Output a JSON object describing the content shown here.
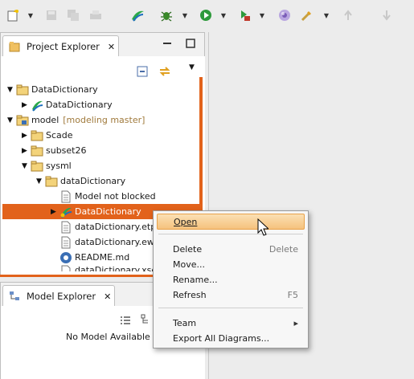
{
  "toolbar": {
    "icons": [
      "new-wizard-icon",
      "save-icon",
      "save-all-icon",
      "print-icon",
      "scade-icon",
      "debug-icon",
      "run-icon",
      "external-tools-icon",
      "globe-icon",
      "tool-icon",
      "back-icon",
      "forward-icon"
    ]
  },
  "project_explorer": {
    "tab_label": "Project Explorer",
    "tree": [
      {
        "label": "DataDictionary",
        "decoration": ""
      },
      {
        "label": "DataDictionary",
        "decoration": ""
      },
      {
        "label": "model",
        "decoration": "[modeling master]"
      },
      {
        "label": "Scade",
        "decoration": ""
      },
      {
        "label": "subset26",
        "decoration": ""
      },
      {
        "label": "sysml",
        "decoration": ""
      },
      {
        "label": "dataDictionary",
        "decoration": ""
      },
      {
        "label": "Model not blocked",
        "decoration": ""
      },
      {
        "label": "DataDictionary",
        "decoration": ""
      },
      {
        "label": "dataDictionary.etp",
        "decoration": ""
      },
      {
        "label": "dataDictionary.ewd",
        "decoration": ""
      },
      {
        "label": "README.md",
        "decoration": ""
      },
      {
        "label": "dataDictionary.xscade",
        "decoration": ""
      }
    ]
  },
  "model_explorer": {
    "tab_label": "Model Explorer",
    "empty_text": "No Model Available"
  },
  "context_menu": {
    "items": [
      {
        "label": "Open",
        "accel": ""
      },
      {
        "label": "Delete",
        "accel": "Delete"
      },
      {
        "label": "Move...",
        "accel": ""
      },
      {
        "label": "Rename...",
        "accel": ""
      },
      {
        "label": "Refresh",
        "accel": "F5"
      },
      {
        "label": "Team",
        "accel": ""
      },
      {
        "label": "Export All Diagrams...",
        "accel": ""
      }
    ],
    "submenu_arrow": "▸"
  },
  "colors": {
    "selection": "#e2621b",
    "menu_highlight": "#f5c27d"
  }
}
